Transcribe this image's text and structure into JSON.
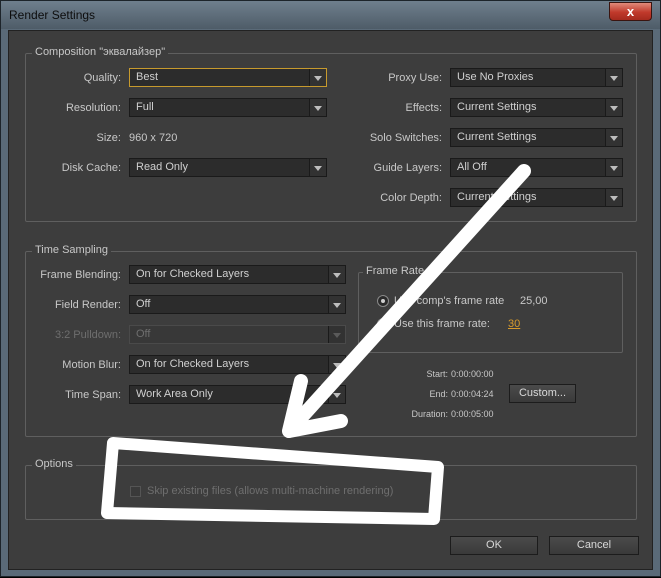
{
  "window": {
    "title": "Render Settings",
    "close_glyph": "x"
  },
  "composition": {
    "legend": "Composition \"эквалайзер\"",
    "quality": {
      "label": "Quality:",
      "value": "Best"
    },
    "resolution": {
      "label": "Resolution:",
      "value": "Full"
    },
    "size": {
      "label": "Size:",
      "value": "960 x 720"
    },
    "disk_cache": {
      "label": "Disk Cache:",
      "value": "Read Only"
    },
    "proxy_use": {
      "label": "Proxy Use:",
      "value": "Use No Proxies"
    },
    "effects": {
      "label": "Effects:",
      "value": "Current Settings"
    },
    "solo_switches": {
      "label": "Solo Switches:",
      "value": "Current Settings"
    },
    "guide_layers": {
      "label": "Guide Layers:",
      "value": "All Off"
    },
    "color_depth": {
      "label": "Color Depth:",
      "value": "Current Settings"
    }
  },
  "time_sampling": {
    "legend": "Time Sampling",
    "frame_blending": {
      "label": "Frame Blending:",
      "value": "On for Checked Layers"
    },
    "field_render": {
      "label": "Field Render:",
      "value": "Off"
    },
    "pulldown": {
      "label": "3:2 Pulldown:",
      "value": "Off"
    },
    "motion_blur": {
      "label": "Motion Blur:",
      "value": "On for Checked Layers"
    },
    "time_span": {
      "label": "Time Span:",
      "value": "Work Area Only"
    },
    "frame_rate": {
      "legend": "Frame Rate",
      "use_comp_label": "Use comp's frame rate",
      "use_comp_value": "25,00",
      "use_this_label": "Use this frame rate:",
      "use_this_value": "30"
    },
    "start": {
      "label": "Start:",
      "value": "0:00:00:00"
    },
    "end": {
      "label": "End:",
      "value": "0:00:04:24"
    },
    "duration": {
      "label": "Duration:",
      "value": "0:00:05:00"
    },
    "custom_button": "Custom..."
  },
  "options": {
    "legend": "Options",
    "skip_existing_label": "Skip existing files (allows multi-machine rendering)"
  },
  "buttons": {
    "ok": "OK",
    "cancel": "Cancel"
  },
  "colors": {
    "panel": "#3d3d3d",
    "focus": "#c79a2d",
    "hot_text": "#d79b2c",
    "annotation": "#ffffff"
  }
}
